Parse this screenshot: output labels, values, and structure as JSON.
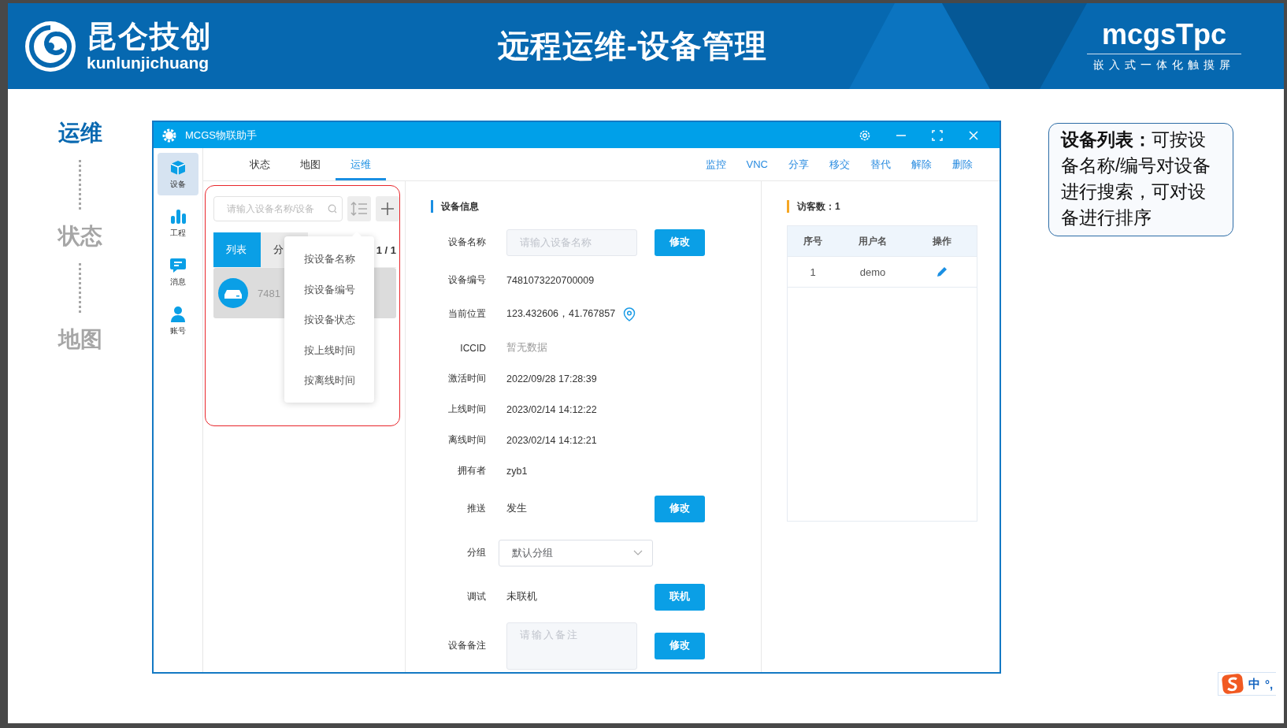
{
  "header": {
    "logo_text": "昆仑技创",
    "logo_subtext": "kunlunjichuang",
    "title": "远程运维-设备管理",
    "brand": "mcgsTpc",
    "brand_subtitle": "嵌入式一体化触摸屏"
  },
  "steps": [
    {
      "label": "运维",
      "selected": true
    },
    {
      "label": "状态",
      "selected": false
    },
    {
      "label": "地图",
      "selected": false
    }
  ],
  "app": {
    "title": "MCGS物联助手",
    "nav": [
      {
        "kind": "device",
        "label": "设备",
        "selected": true
      },
      {
        "kind": "project",
        "label": "工程",
        "selected": false
      },
      {
        "kind": "message",
        "label": "消息",
        "selected": false
      },
      {
        "kind": "account",
        "label": "账号",
        "selected": false
      }
    ],
    "tabs": [
      {
        "label": "状态",
        "selected": false
      },
      {
        "label": "地图",
        "selected": false
      },
      {
        "label": "运维",
        "selected": true
      }
    ],
    "actions": [
      "监控",
      "VNC",
      "分享",
      "移交",
      "替代",
      "解除",
      "删除"
    ],
    "device_list": {
      "search_placeholder": "请输入设备名称/设备",
      "view_tabs": [
        {
          "label": "列表",
          "selected": true
        },
        {
          "label": "分",
          "selected": false
        }
      ],
      "pagination": "1 / 1",
      "devices": [
        {
          "number": "7481",
          "selected": true
        }
      ],
      "sort_menu": [
        "按设备名称",
        "按设备编号",
        "按设备状态",
        "按上线时间",
        "按离线时间"
      ]
    },
    "info": {
      "title": "设备信息",
      "rows": [
        {
          "kind": "input",
          "label": "设备名称",
          "placeholder": "请输入设备名称",
          "button": "修改"
        },
        {
          "kind": "text",
          "label": "设备编号",
          "value": "7481073220700009"
        },
        {
          "kind": "location",
          "label": "当前位置",
          "value": "123.432606，41.767857"
        },
        {
          "kind": "empty",
          "label": "ICCID",
          "value": "暂无数据"
        },
        {
          "kind": "text",
          "label": "激活时间",
          "value": "2022/09/28 17:28:39"
        },
        {
          "kind": "text",
          "label": "上线时间",
          "value": "2023/02/14 14:12:22"
        },
        {
          "kind": "text",
          "label": "离线时间",
          "value": "2023/02/14 14:12:21"
        },
        {
          "kind": "text",
          "label": "拥有者",
          "value": "zyb1"
        },
        {
          "kind": "text",
          "label": "推送",
          "value": "发生",
          "button": "修改"
        },
        {
          "kind": "select",
          "label": "分组",
          "value": "默认分组"
        },
        {
          "kind": "text",
          "label": "调试",
          "value": "未联机",
          "button": "联机"
        },
        {
          "kind": "textarea",
          "label": "设备备注",
          "placeholder": "请输入备注",
          "button": "修改"
        }
      ]
    },
    "visitors": {
      "title": "访客数：1",
      "columns": [
        "序号",
        "用户名",
        "操作"
      ],
      "rows": [
        {
          "index": "1",
          "user": "demo"
        }
      ]
    }
  },
  "callout": "**设备列表：**可按设备名称/编号对设备进行搜索，可对设备进行排序",
  "ime": {
    "mode": "中",
    "punctuation": "°,"
  }
}
